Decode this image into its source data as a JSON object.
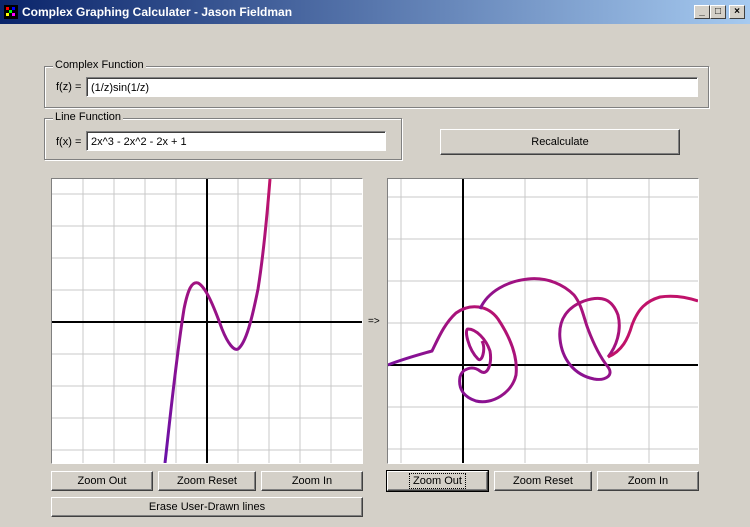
{
  "window": {
    "title": "Complex Graphing Calculater - Jason Fieldman",
    "minimize_glyph": "_",
    "maximize_glyph": "□",
    "close_glyph": "×"
  },
  "complex_function": {
    "group_label": "Complex Function",
    "prefix": "f(z) =",
    "value": "(1/z)sin(1/z)"
  },
  "line_function": {
    "group_label": "Line Function",
    "prefix": "f(x) =",
    "value": "2x^3 - 2x^2 - 2x + 1"
  },
  "recalculate_label": "Recalculate",
  "mapping_arrow": "=>",
  "left_plot": {
    "zoom_out_label": "Zoom Out",
    "zoom_reset_label": "Zoom Reset",
    "zoom_in_label": "Zoom In",
    "erase_label": "Erase User-Drawn lines"
  },
  "right_plot": {
    "zoom_out_label": "Zoom Out",
    "zoom_reset_label": "Zoom Reset",
    "zoom_in_label": "Zoom In"
  },
  "colors": {
    "curve_start": "#6a11a8",
    "curve_end": "#c0126a",
    "grid": "#c8c8c8",
    "axis": "#000000"
  }
}
